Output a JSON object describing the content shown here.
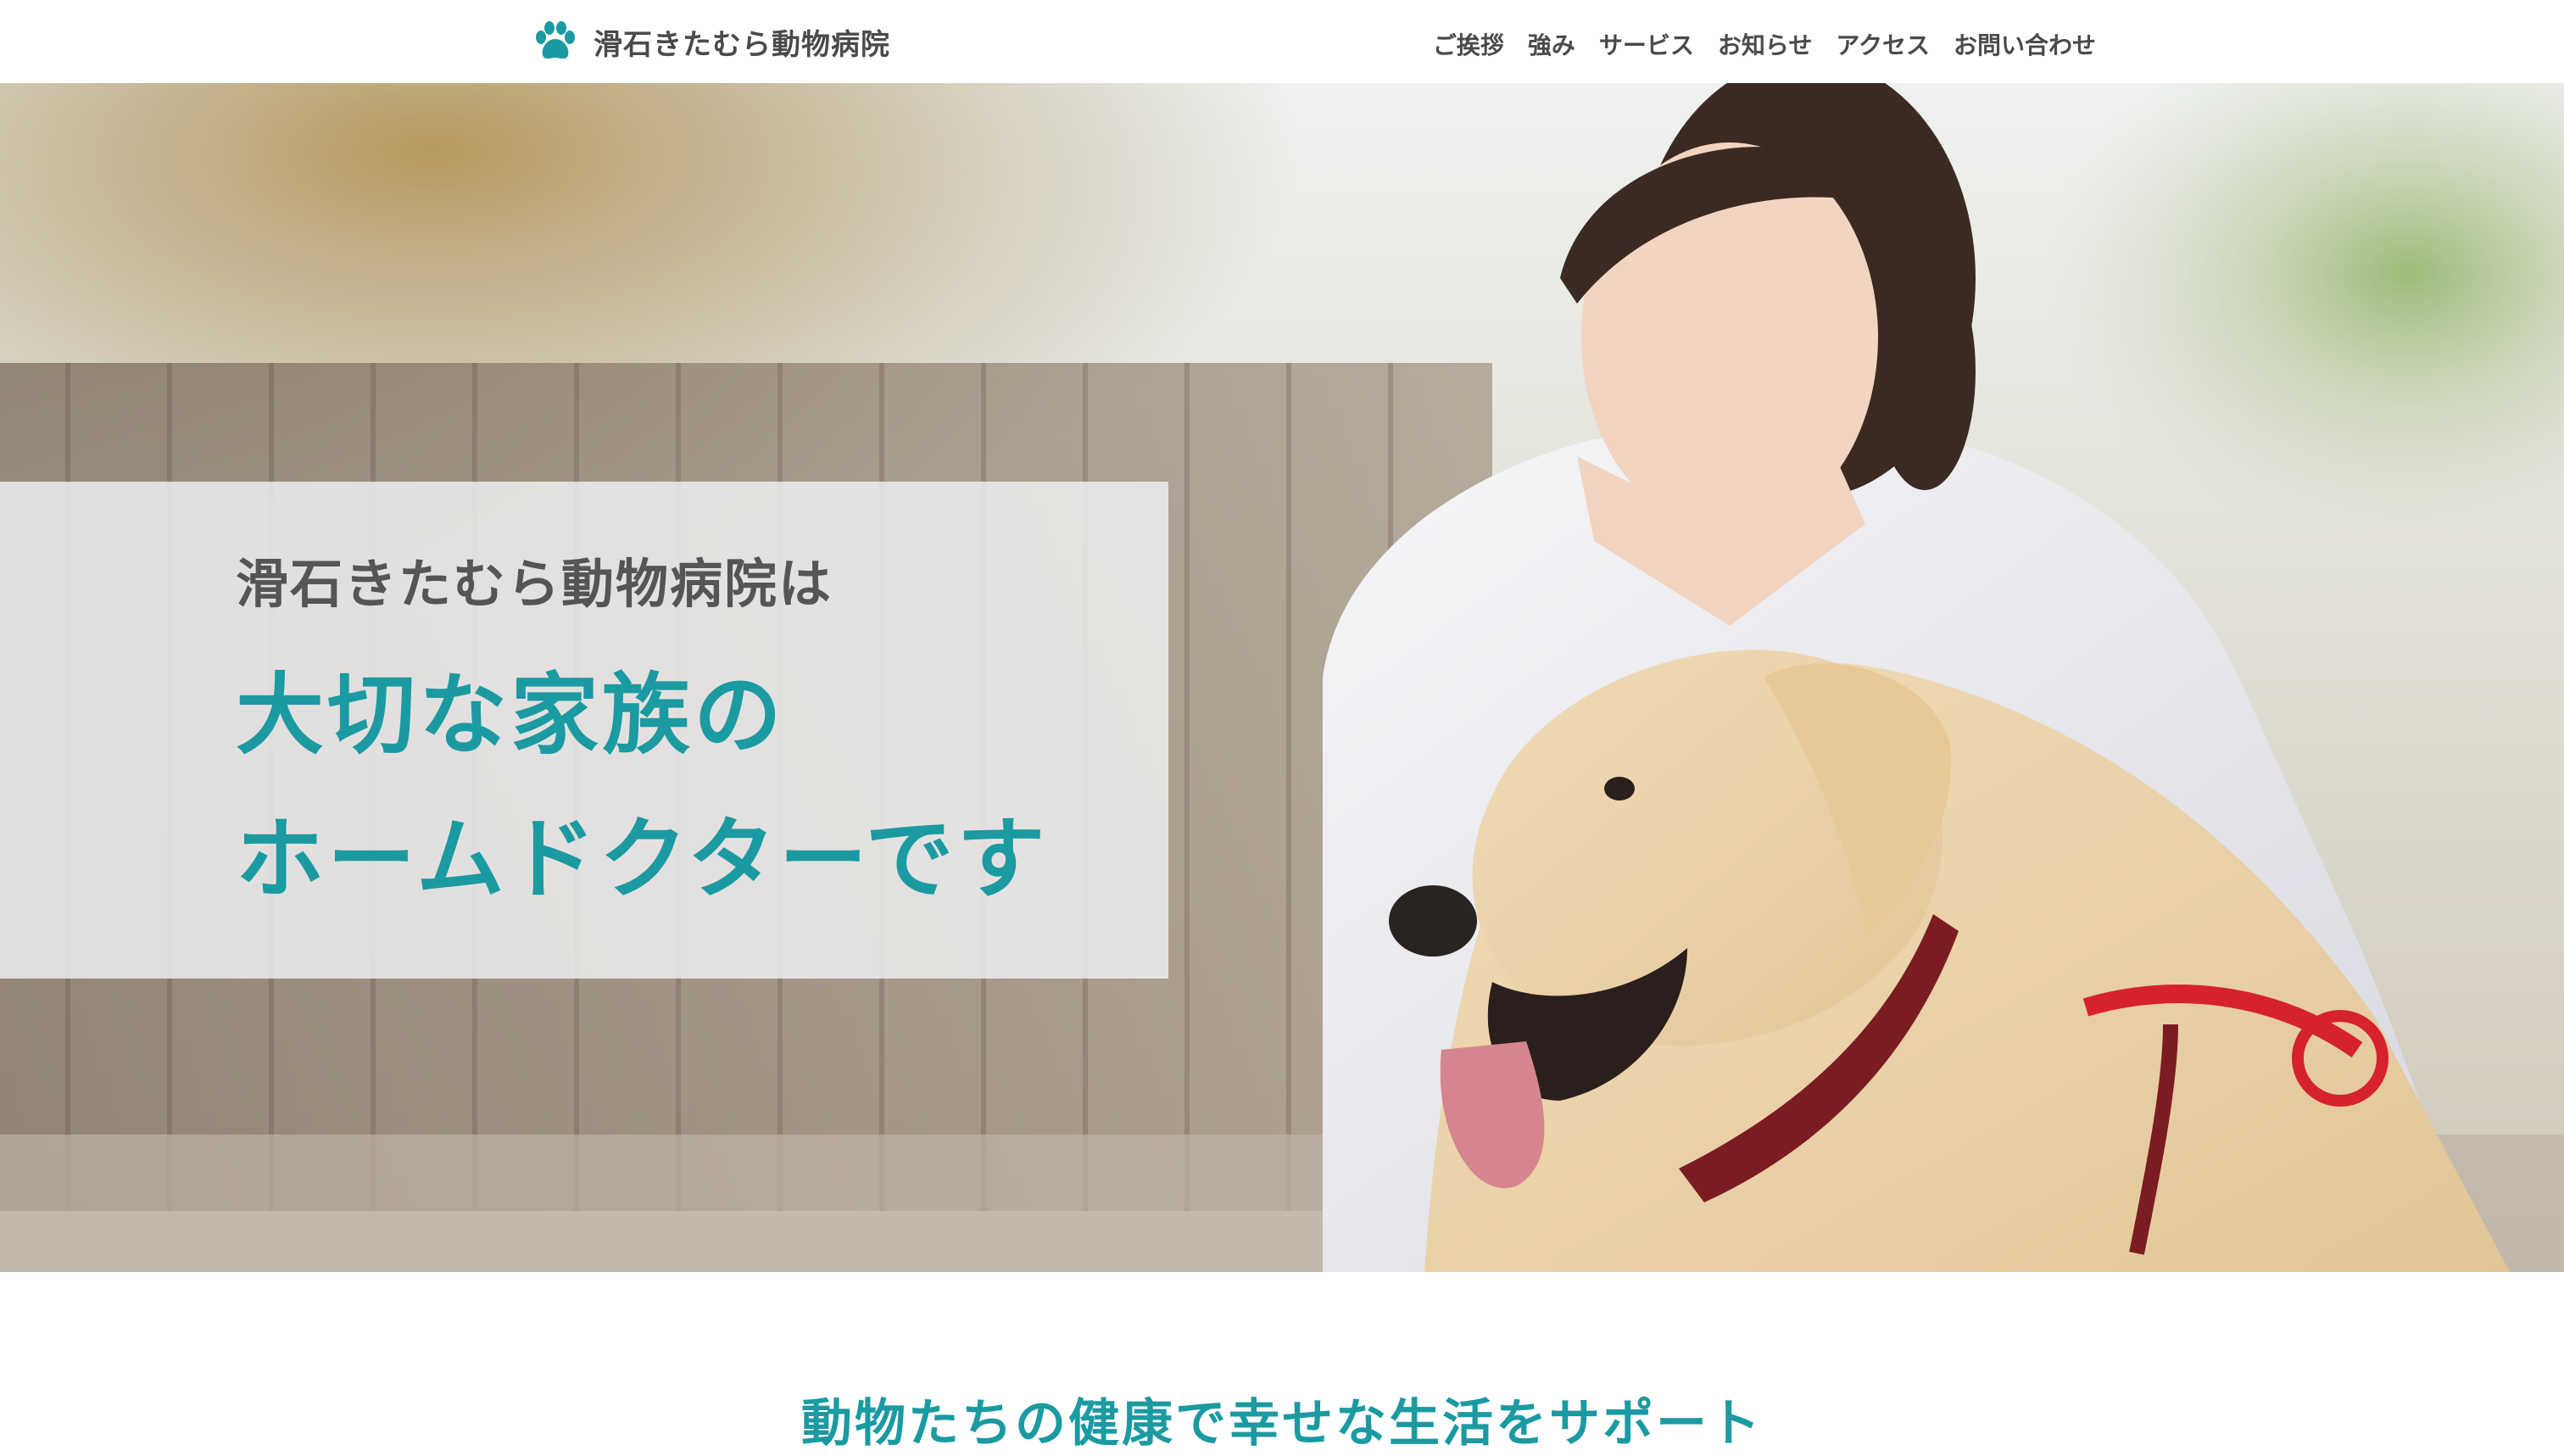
{
  "header": {
    "brand_name": "滑石きたむら動物病院",
    "nav": [
      "ご挨拶",
      "強み",
      "サービス",
      "お知らせ",
      "アクセス",
      "お問い合わせ"
    ]
  },
  "hero": {
    "lead": "滑石きたむら動物病院は",
    "title_line1": "大切な家族の",
    "title_line2": "ホームドクターです"
  },
  "section": {
    "heading": "動物たちの健康で幸せな生活をサポート"
  },
  "colors": {
    "accent": "#1b9aa2",
    "text": "#4a4a4a"
  },
  "icons": {
    "brand": "paw-icon"
  }
}
